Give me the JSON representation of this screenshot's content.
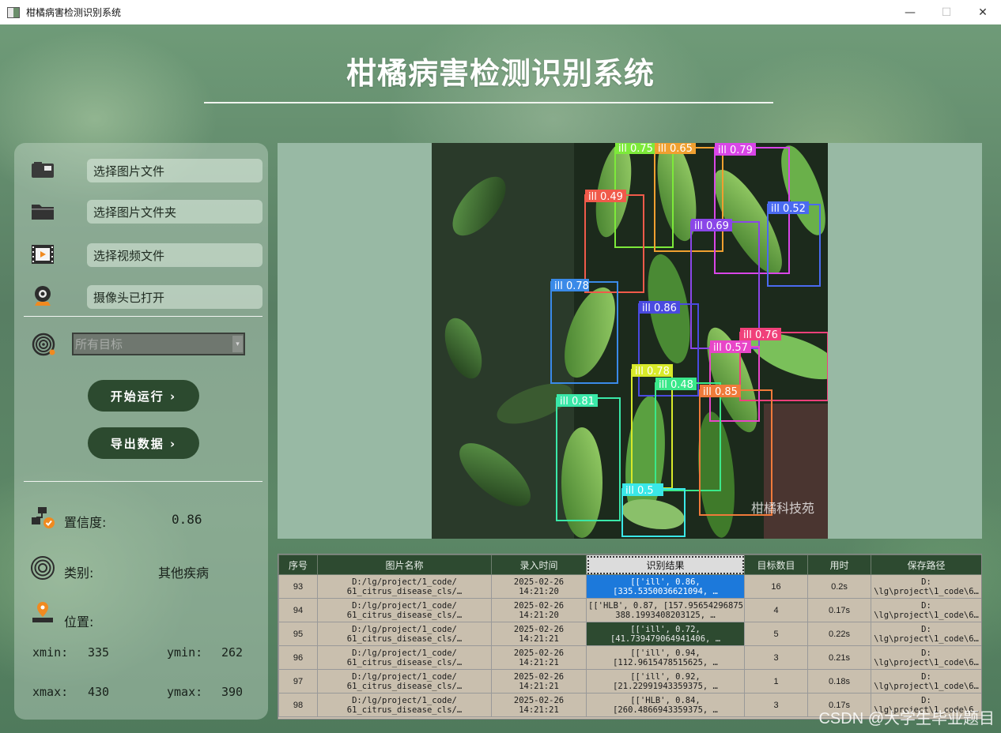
{
  "window": {
    "title": "柑橘病害检测识别系统",
    "min": "—",
    "max": "☐",
    "close": "✕"
  },
  "header": {
    "title": "柑橘病害检测识别系统"
  },
  "sidebar": {
    "items": [
      {
        "label": "选择图片文件",
        "icon": "image-file-icon"
      },
      {
        "label": "选择图片文件夹",
        "icon": "folder-icon"
      },
      {
        "label": "选择视频文件",
        "icon": "video-file-icon"
      },
      {
        "label": "摄像头已打开",
        "icon": "camera-icon"
      }
    ],
    "target_select": {
      "value": "所有目标",
      "caret": "▾"
    },
    "run_button": "开始运行 ›",
    "export_button": "导出数据 ›",
    "confidence": {
      "label": "置信度:",
      "value": "0.86"
    },
    "category": {
      "label": "类别:",
      "value": "其他疾病"
    },
    "position": {
      "label": "位置:",
      "xmin_label": "xmin:",
      "xmin": "335",
      "ymin_label": "ymin:",
      "ymin": "262",
      "xmax_label": "xmax:",
      "xmax": "430",
      "ymax_label": "ymax:",
      "ymax": "390"
    }
  },
  "detections": [
    {
      "label": "ill 0.75",
      "color": "#7dea3a"
    },
    {
      "label": "ill 0.65",
      "color": "#f0a030"
    },
    {
      "label": "ill 0.79",
      "color": "#d946e8"
    },
    {
      "label": "ill 0.49",
      "color": "#f05a4a"
    },
    {
      "label": "ill 0.52",
      "color": "#4a6af0"
    },
    {
      "label": "ill 0.69",
      "color": "#8a46e8"
    },
    {
      "label": "ill 0.78",
      "color": "#3a8ae8"
    },
    {
      "label": "ill 0.86",
      "color": "#4a4ae0"
    },
    {
      "label": "ill 0.76",
      "color": "#f0407a"
    },
    {
      "label": "ill 0.57",
      "color": "#e846c8"
    },
    {
      "label": "ill 0.78",
      "color": "#d8ea2a"
    },
    {
      "label": "ill 0.48",
      "color": "#3ae88a"
    },
    {
      "label": "ill 0.85",
      "color": "#f07a3a"
    },
    {
      "label": "ill 0.81",
      "color": "#3ae8a8"
    },
    {
      "label": "ill 0.5",
      "color": "#3ae8e8"
    }
  ],
  "photo_watermark": "柑橘科技苑",
  "table": {
    "headers": [
      "序号",
      "图片名称",
      "录入时间",
      "识别结果",
      "目标数目",
      "用时",
      "保存路径"
    ],
    "rows": [
      {
        "id": "93",
        "name": [
          "D:/lg/project/1_code/",
          "61_citrus_disease_cls/…"
        ],
        "time": [
          "2025-02-26",
          "14:21:20"
        ],
        "result": [
          "[['ill', 0.86,",
          "[335.5350036621094, …"
        ],
        "count": "16",
        "used": "0.2s",
        "path": [
          "D:",
          "\\lg\\project\\1_code\\6…"
        ]
      },
      {
        "id": "94",
        "name": [
          "D:/lg/project/1_code/",
          "61_citrus_disease_cls/…"
        ],
        "time": [
          "2025-02-26",
          "14:21:20"
        ],
        "result": [
          "[['HLB', 0.87, [157.95654296875,",
          "388.1993408203125, …"
        ],
        "count": "4",
        "used": "0.17s",
        "path": [
          "D:",
          "\\lg\\project\\1_code\\6…"
        ]
      },
      {
        "id": "95",
        "name": [
          "D:/lg/project/1_code/",
          "61_citrus_disease_cls/…"
        ],
        "time": [
          "2025-02-26",
          "14:21:21"
        ],
        "result": [
          "[['ill', 0.72,",
          "[41.739479064941406, …"
        ],
        "count": "5",
        "used": "0.22s",
        "path": [
          "D:",
          "\\lg\\project\\1_code\\6…"
        ]
      },
      {
        "id": "96",
        "name": [
          "D:/lg/project/1_code/",
          "61_citrus_disease_cls/…"
        ],
        "time": [
          "2025-02-26",
          "14:21:21"
        ],
        "result": [
          "[['ill', 0.94,",
          "[112.9615478515625, …"
        ],
        "count": "3",
        "used": "0.21s",
        "path": [
          "D:",
          "\\lg\\project\\1_code\\6…"
        ]
      },
      {
        "id": "97",
        "name": [
          "D:/lg/project/1_code/",
          "61_citrus_disease_cls/…"
        ],
        "time": [
          "2025-02-26",
          "14:21:21"
        ],
        "result": [
          "[['ill', 0.92,",
          "[21.22991943359375, …"
        ],
        "count": "1",
        "used": "0.18s",
        "path": [
          "D:",
          "\\lg\\project\\1_code\\6…"
        ]
      },
      {
        "id": "98",
        "name": [
          "D:/lg/project/1_code/",
          "61_citrus_disease_cls/…"
        ],
        "time": [
          "2025-02-26",
          "14:21:21"
        ],
        "result": [
          "[['HLB', 0.84,",
          "[260.4866943359375, …"
        ],
        "count": "3",
        "used": "0.17s",
        "path": [
          "D:",
          "\\lg\\project\\1_code\\6…"
        ]
      }
    ]
  },
  "watermark": "CSDN @大学生毕业题目"
}
